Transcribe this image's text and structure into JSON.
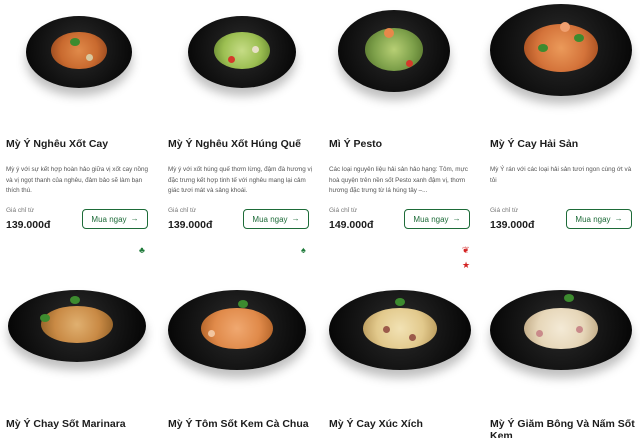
{
  "products": [
    {
      "title": "Mỳ Ý Nghêu Xốt Cay",
      "description": "Mỳ ý với sự kết hợp hoàn hảo giữa vị xốt cay nồng và vị ngọt thanh của nghêu, đảm bảo sẽ làm bạn thích thú.",
      "price_label": "Giá chỉ từ",
      "price": "139.000đ",
      "buy_label": "Mua ngay",
      "food_color": "#c96a2f",
      "tag_icon": "broccoli-icon"
    },
    {
      "title": "Mỳ Ý Nghêu Xốt Húng Quế",
      "description": "Mỳ ý với xốt húng quế thơm lừng, đậm đà hương vị đặc trưng kết hợp tinh tế với nghêu mang lại cảm giác tươi mát và sảng khoái.",
      "price_label": "Giá chỉ từ",
      "price": "139.000đ",
      "buy_label": "Mua ngay",
      "food_color": "#9cbf52",
      "tag_icon": "leaf-icon"
    },
    {
      "title": "Mì Ý Pesto",
      "description": "Các loại nguyên liệu hải sản hảo hạng: Tôm, mực hoà quyện trên nền sốt Pesto xanh đậm vị, thơm hương đặc trưng từ lá húng tây –...",
      "price_label": "Giá chỉ từ",
      "price": "149.000đ",
      "buy_label": "Mua ngay",
      "food_color": "#7da04a",
      "tag_icon": "chili-star-icon"
    },
    {
      "title": "Mỳ Ý Cay Hải Sản",
      "description": "Mỳ Ý rán với các loại hải sản tươi ngon cùng ớt và tỏi",
      "price_label": "Giá chỉ từ",
      "price": "139.000đ",
      "buy_label": "Mua ngay",
      "food_color": "#d4733a",
      "tag_icon": ""
    },
    {
      "title": "Mỳ Ý Chay Sốt Marinara",
      "food_color": "#c98a45"
    },
    {
      "title": "Mỳ Ý Tôm Sốt Kem Cà Chua",
      "food_color": "#e08a4a"
    },
    {
      "title": "Mỳ Ý Cay Xúc Xích",
      "food_color": "#e2c98c"
    },
    {
      "title": "Mỳ Ý Giăm Bông Và Nấm Sốt Kem",
      "food_color": "#e6d6b8"
    }
  ],
  "tags": {
    "broccoli": "♣",
    "leaf": "♠",
    "chili": "❦",
    "star": "★"
  },
  "colors": {
    "accent": "#1d6b38",
    "tag_green": "#1f7a3a",
    "tag_red": "#d32222"
  }
}
